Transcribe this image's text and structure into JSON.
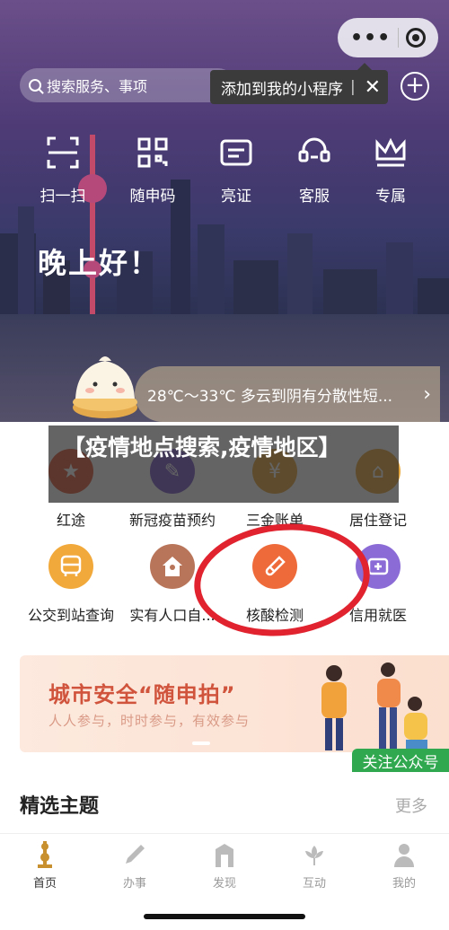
{
  "topbar": {
    "search_placeholder": "搜索服务、事项",
    "tooltip_text": "添加到我的小程序",
    "tooltip_bar": "|",
    "tooltip_close": "✕",
    "more_dots": "•••",
    "plus": "+"
  },
  "quick_actions": [
    {
      "label": "扫一扫",
      "icon": "scan-icon"
    },
    {
      "label": "随申码",
      "icon": "qr-code-icon"
    },
    {
      "label": "亮证",
      "icon": "id-card-icon"
    },
    {
      "label": "客服",
      "icon": "headset-icon"
    },
    {
      "label": "专属",
      "icon": "crown-icon"
    }
  ],
  "greeting": "晚上好！",
  "weather": {
    "text": "28℃～33℃ 多云到阴有分散性短...",
    "chevron": "›"
  },
  "overlay_title": "【疫情地点搜索,疫情地区】",
  "services_row1": [
    {
      "label": "红途",
      "icon": "star-icon",
      "color": "#e05a3a"
    },
    {
      "label": "新冠疫苗预约",
      "icon": "syringe-icon",
      "color": "#7b5cc9"
    },
    {
      "label": "三金账单",
      "icon": "bill-icon",
      "color": "#e8a73a"
    },
    {
      "label": "居住登记",
      "icon": "home-register-icon",
      "color": "#e8a73a"
    }
  ],
  "services_row2": [
    {
      "label": "公交到站查询",
      "icon": "bus-icon",
      "color": "#f2a93b"
    },
    {
      "label": "实有人口自...",
      "icon": "house-person-icon",
      "color": "#b9755a"
    },
    {
      "label": "核酸检测",
      "icon": "test-tube-icon",
      "color": "#ef6a3a"
    },
    {
      "label": "信用就医",
      "icon": "medical-card-icon",
      "color": "#8b6cd6"
    }
  ],
  "banner": {
    "title": "城市安全“随申拍”",
    "subtitle": "人人参与，时时参与，有效参与"
  },
  "follow_label": "关注公众号",
  "section": {
    "title": "精选主题",
    "more": "更多"
  },
  "tabs": [
    {
      "label": "首页",
      "icon": "home-tower-icon",
      "active": true
    },
    {
      "label": "办事",
      "icon": "pen-icon",
      "active": false
    },
    {
      "label": "发现",
      "icon": "building-icon",
      "active": false
    },
    {
      "label": "互动",
      "icon": "flower-icon",
      "active": false
    },
    {
      "label": "我的",
      "icon": "person-icon",
      "active": false
    }
  ],
  "colors": {
    "accent_red": "#e0232e",
    "follow_green": "#2fa84f",
    "banner_text": "#d0533c"
  }
}
